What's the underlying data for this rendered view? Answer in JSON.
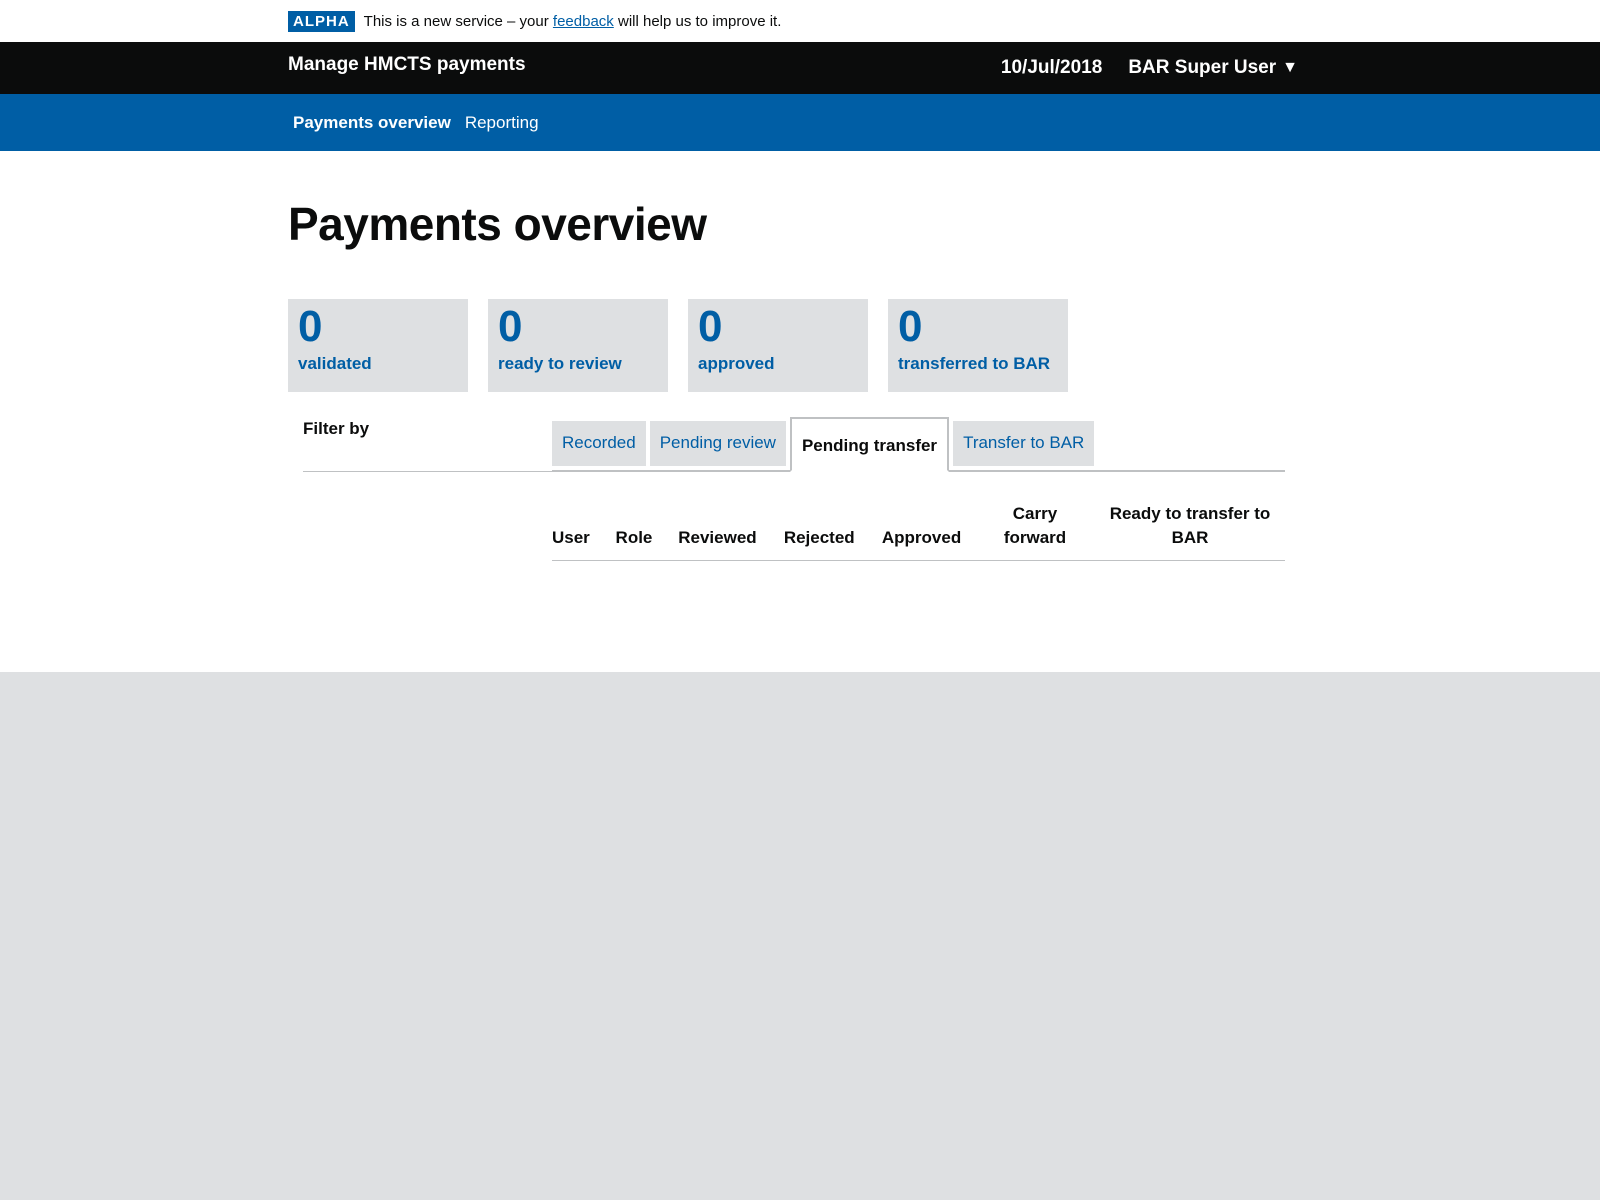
{
  "phase_banner": {
    "tag": "ALPHA",
    "text_before": "This is a new service – your",
    "link": "feedback",
    "text_after": "will help us to improve it."
  },
  "header": {
    "service_name": "Manage HMCTS payments",
    "date": "10/Jul/2018",
    "user": "BAR Super User",
    "user_caret": "▼"
  },
  "nav": {
    "items": [
      {
        "label": "Payments overview"
      },
      {
        "label": "Reporting"
      }
    ]
  },
  "main": {
    "title": "Payments overview",
    "stats": [
      {
        "value": "0",
        "label": "validated"
      },
      {
        "value": "0",
        "label": "ready to review"
      },
      {
        "value": "0",
        "label": "approved"
      },
      {
        "value": "0",
        "label": "transferred to BAR"
      }
    ],
    "filter_title": "Filter by",
    "tabs": [
      {
        "label": "Recorded"
      },
      {
        "label": "Pending review"
      },
      {
        "label": "Pending transfer"
      },
      {
        "label": "Transfer to BAR"
      }
    ],
    "table": {
      "columns": [
        "User",
        "Role",
        "Reviewed",
        "Rejected",
        "Approved",
        "Carry forward",
        "Ready to transfer to BAR"
      ],
      "rows": []
    }
  },
  "colors": {
    "brand_blue": "#005ea5",
    "header_black": "#0b0c0c",
    "grey": "#dee0e2"
  }
}
